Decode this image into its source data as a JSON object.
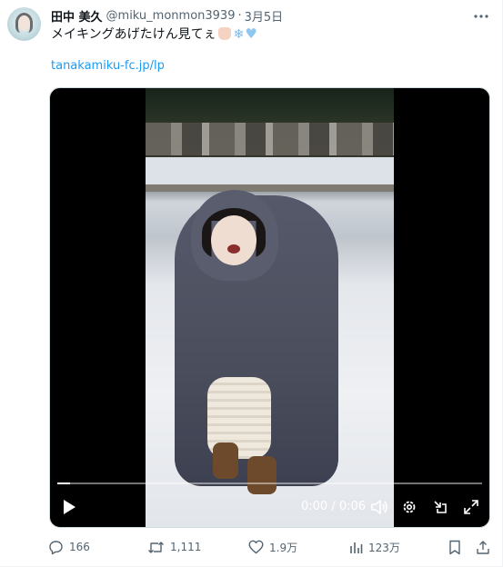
{
  "tweet": {
    "author_name": "田中 美久",
    "handle": "@miku_monmon3939",
    "separator": "·",
    "date": "3月5日",
    "more_icon": "more-horizontal-icon",
    "text": "メイキングあげたけん見てぇ",
    "link_text": "tanakamiku-fc.jp/lp"
  },
  "video": {
    "time_display": "0:00 / 0:06",
    "progress_fraction": 0.03
  },
  "actions": {
    "replies": "166",
    "retweets": "1,111",
    "likes": "1.9万",
    "views": "123万"
  },
  "colors": {
    "link": "#1d9bf0",
    "muted": "#536471",
    "text": "#0f1419"
  }
}
